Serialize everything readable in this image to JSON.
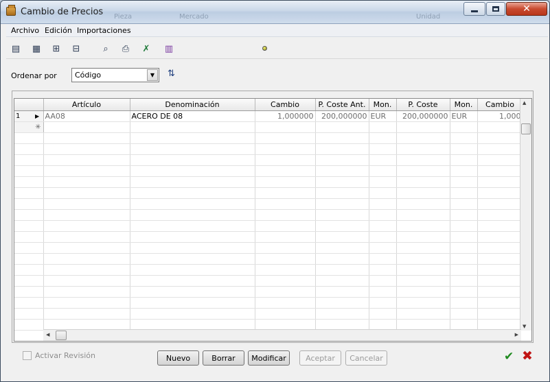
{
  "window": {
    "title": "Cambio de Precios"
  },
  "background_ghost": [
    "Pieza",
    "Mercado",
    "Unidad"
  ],
  "menu": [
    "Archivo",
    "Edición",
    "Importaciones"
  ],
  "toolbar": {
    "icons": [
      "new-document-icon",
      "grid-table-icon",
      "tree-view-icon",
      "hierarchy-icon",
      "print-preview-icon",
      "print-icon",
      "excel-export-icon",
      "report-icon"
    ],
    "status_light": "yellow"
  },
  "sort": {
    "label": "Ordenar por",
    "value": "Código"
  },
  "grid": {
    "columns": [
      "Artículo",
      "Denominación",
      "Cambio",
      "P. Coste Ant.",
      "Mon.",
      "P. Coste",
      "Mon.",
      "Cambio"
    ],
    "rows": [
      {
        "num": "1",
        "articulo": "AA08",
        "denominacion": "ACERO DE 08",
        "cambio": "1,000000",
        "coste_ant": "200,000000",
        "mon_ant": "EUR",
        "coste": "200,000000",
        "mon": "EUR",
        "cambio2": "1,000"
      }
    ],
    "new_row_marker": "✳"
  },
  "footer": {
    "revision_label": "Activar Revisión",
    "buttons": {
      "nuevo": "Nuevo",
      "borrar": "Borrar",
      "modificar": "Modificar",
      "aceptar": "Aceptar",
      "cancelar": "Cancelar"
    }
  }
}
